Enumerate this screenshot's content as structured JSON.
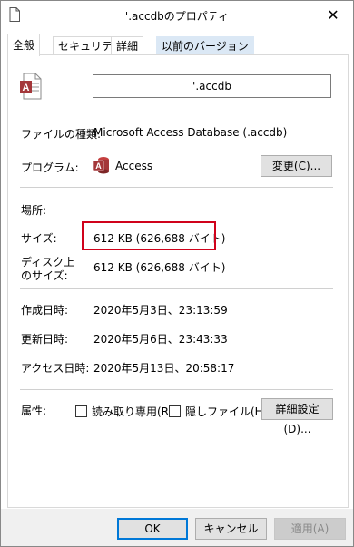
{
  "window": {
    "title": "'.accdbのプロパティ",
    "close_glyph": "✕"
  },
  "tabs": [
    {
      "label": "全般",
      "active": true
    },
    {
      "label": "セキュリティ",
      "active": false
    },
    {
      "label": "詳細",
      "active": false
    },
    {
      "label": "以前のバージョン",
      "active": false
    }
  ],
  "general": {
    "filename": "'.accdb",
    "file_type_label": "ファイルの種類:",
    "file_type_value": "Microsoft Access Database (.accdb)",
    "program_label": "プログラム:",
    "program_value": "Access",
    "change_button": "変更(C)...",
    "location_label": "場所:",
    "location_value": "",
    "size_label": "サイズ:",
    "size_value": "612 KB (626,688 バイト)",
    "disk_size_label_line1": "ディスク上",
    "disk_size_label_line2": "のサイズ:",
    "disk_size_value": "612 KB (626,688 バイト)",
    "created_label": "作成日時:",
    "created_value": "2020年5月3日、23:13:59",
    "modified_label": "更新日時:",
    "modified_value": "2020年5月6日、23:43:33",
    "accessed_label": "アクセス日時:",
    "accessed_value": "2020年5月13日、20:58:17",
    "attributes_label": "属性:",
    "readonly_label": "読み取り専用(R)",
    "hidden_label": "隠しファイル(H)",
    "advanced_button": "詳細設定(D)..."
  },
  "footer": {
    "ok": "OK",
    "cancel": "キャンセル",
    "apply": "適用(A)"
  },
  "colors": {
    "access_red": "#a4373a",
    "highlight_red": "#d0021b",
    "accent_blue": "#0078d7"
  },
  "icons": {
    "file": "access-file-icon",
    "program": "access-app-icon"
  }
}
